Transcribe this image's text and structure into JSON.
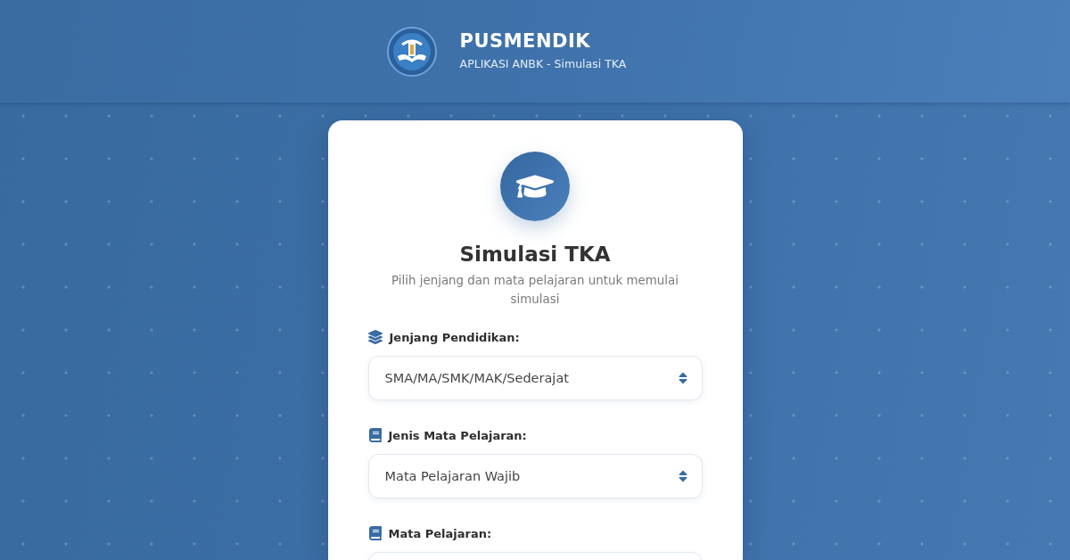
{
  "header": {
    "title": "PUSMENDIK",
    "subtitle": "APLIKASI ANBK - Simulasi TKA"
  },
  "card": {
    "title": "Simulasi TKA",
    "subtitle": "Pilih jenjang dan mata pelajaran untuk memulai simulasi",
    "fields": [
      {
        "label": "Jenjang Pendidikan:",
        "value": "SMA/MA/SMK/MAK/Sederajat"
      },
      {
        "label": "Jenis Mata Pelajaran:",
        "value": "Mata Pelajaran Wajib"
      },
      {
        "label": "Mata Pelajaran:"
      }
    ]
  }
}
